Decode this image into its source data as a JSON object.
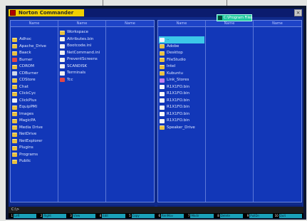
{
  "window": {
    "title": "Norton Commander",
    "close_glyph": "×"
  },
  "left_panel": {
    "columns": [
      "Name",
      "Name",
      "Name"
    ],
    "path": "",
    "col1": [
      {
        "name": "Adhoc",
        "icon": "folder"
      },
      {
        "name": "Apache_Drive",
        "icon": "folder"
      },
      {
        "name": "Baack",
        "icon": "folder"
      },
      {
        "name": "Burner",
        "icon": "exe"
      },
      {
        "name": "CDROM",
        "icon": "folder"
      },
      {
        "name": "CDBurner",
        "icon": "drive"
      },
      {
        "name": "CDStore",
        "icon": "folder"
      },
      {
        "name": "Chat",
        "icon": "folder"
      },
      {
        "name": "ClickCyc",
        "icon": "folder"
      },
      {
        "name": "ClickPlus",
        "icon": "doc"
      },
      {
        "name": "EquipPMI",
        "icon": "folder"
      },
      {
        "name": "Images",
        "icon": "folder"
      },
      {
        "name": "MagicPA",
        "icon": "folder"
      },
      {
        "name": "Media Drive",
        "icon": "folder"
      },
      {
        "name": "NetDrive",
        "icon": "folder"
      },
      {
        "name": "NetExplorer",
        "icon": "folder"
      },
      {
        "name": "Plugins",
        "icon": "folder"
      },
      {
        "name": "Programs",
        "icon": "folder"
      },
      {
        "name": "Public",
        "icon": "folder"
      }
    ],
    "col2": [
      {
        "name": "Workspace",
        "icon": "folder"
      },
      {
        "name": "Attributes.bin",
        "icon": "doc"
      },
      {
        "name": "Bootcode.ini",
        "icon": "doc"
      },
      {
        "name": "NetCommand.ini",
        "icon": "doc"
      },
      {
        "name": "PreventScreens",
        "icon": "doc"
      },
      {
        "name": "SCANDISK",
        "icon": "doc"
      },
      {
        "name": "Terminals",
        "icon": "doc"
      },
      {
        "name": "Tcc",
        "icon": "exe"
      }
    ],
    "status": ""
  },
  "right_panel": {
    "columns": [
      "Name",
      "Name",
      "Name"
    ],
    "path": "C:\\Program Files",
    "col1": [
      {
        "name": "..",
        "icon": "up",
        "selected": true
      },
      {
        "name": "Adobe",
        "icon": "folder"
      },
      {
        "name": "Desktop",
        "icon": "folder"
      },
      {
        "name": "FileStudio",
        "icon": "folder"
      },
      {
        "name": "Intel",
        "icon": "folder"
      },
      {
        "name": "Kubuntu",
        "icon": "folder"
      },
      {
        "name": "Link_Stores",
        "icon": "link"
      },
      {
        "name": "R1X1FO.bin",
        "icon": "arrow"
      },
      {
        "name": "R1X1FO.bin",
        "icon": "arrow"
      },
      {
        "name": "R1X1FO.bin",
        "icon": "arrow"
      },
      {
        "name": "R1X1FO.bin",
        "icon": "arrow"
      },
      {
        "name": "R1X1FO.bin",
        "icon": "arrow"
      },
      {
        "name": "R1X1FO.bin",
        "icon": "arrow"
      },
      {
        "name": "Speaker_Drive",
        "icon": "folder"
      }
    ],
    "status": ""
  },
  "command_line": "C:\\>",
  "fkeys": [
    {
      "n": "1",
      "label": "Left"
    },
    {
      "n": "2",
      "label": "Right"
    },
    {
      "n": "3",
      "label": "View"
    },
    {
      "n": "4",
      "label": "Edit"
    },
    {
      "n": "5",
      "label": "Copy"
    },
    {
      "n": "6",
      "label": "RenMov"
    },
    {
      "n": "7",
      "label": "Mkdir"
    },
    {
      "n": "8",
      "label": "Delete"
    },
    {
      "n": "9",
      "label": "PullDn"
    },
    {
      "n": "10",
      "label": "Quit"
    }
  ]
}
